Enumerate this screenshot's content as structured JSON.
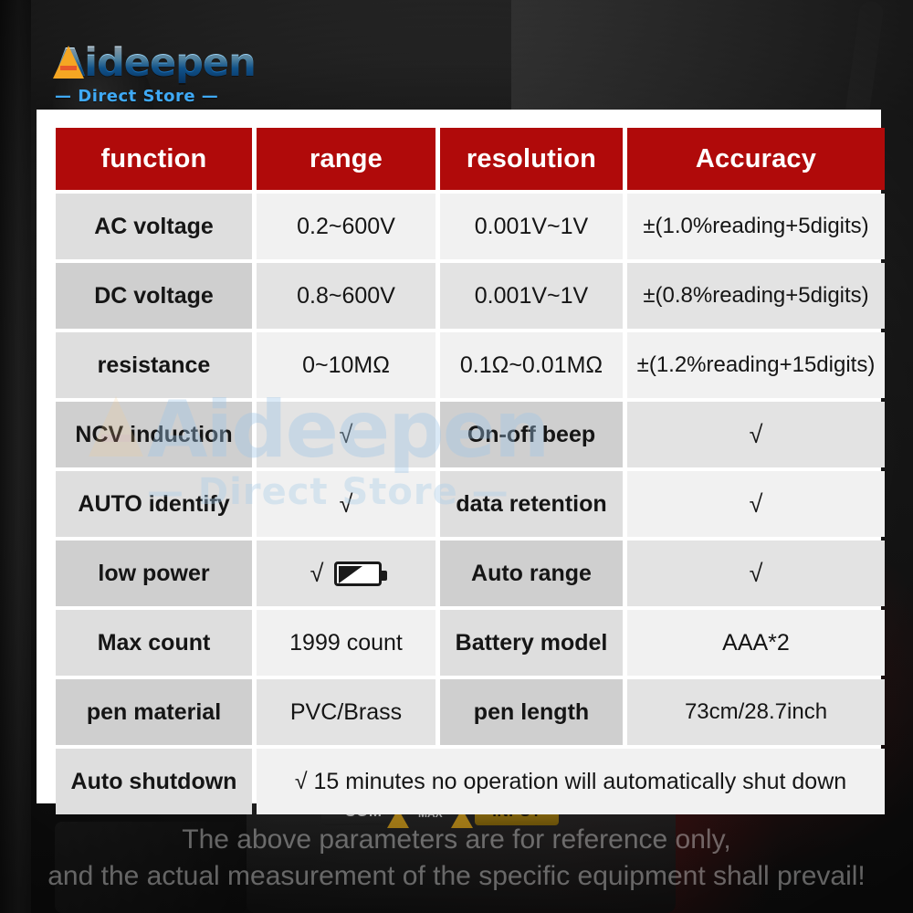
{
  "brand": {
    "name": "Aideepen",
    "tagline": "— Direct Store —",
    "watermark_name": "Aideepen",
    "watermark_tagline": "— Direct Store —",
    "logo_accent": "#f5a623",
    "logo_blue": "#1b7fd4"
  },
  "table": {
    "header_bg": "#b00a0a",
    "headers": [
      "function",
      "range",
      "resolution",
      "Accuracy"
    ],
    "rows": [
      {
        "cells": [
          "AC voltage",
          "0.2~600V",
          "0.001V~1V",
          "±(1.0%reading+5digits)"
        ]
      },
      {
        "cells": [
          "DC voltage",
          "0.8~600V",
          "0.001V~1V",
          "±(0.8%reading+5digits)"
        ]
      },
      {
        "cells": [
          "resistance",
          "0~10MΩ",
          "0.1Ω~0.01MΩ",
          "±(1.2%reading+15digits)"
        ]
      },
      {
        "cells": [
          "NCV induction",
          "√",
          "On-off beep",
          "√"
        ]
      },
      {
        "cells": [
          "AUTO identify",
          "√",
          "data retention",
          "√"
        ]
      },
      {
        "cells": [
          "low power",
          "√",
          "Auto range",
          "√"
        ],
        "icon": "battery-low-icon"
      },
      {
        "cells": [
          "Max count",
          "1999 count",
          "Battery model",
          "AAA*2"
        ]
      },
      {
        "cells": [
          "pen material",
          "PVC/Brass",
          "pen length",
          "73cm/28.7inch"
        ]
      }
    ],
    "last_row": {
      "label": "Auto shutdown",
      "value": "√ 15 minutes no operation will automatically shut down"
    }
  },
  "footer": {
    "line1": "The above parameters are for reference only,",
    "line2": "and the actual measurement of the specific equipment shall prevail!"
  },
  "background": {
    "jack_com": "COM",
    "jack_input": "INPUT",
    "max_label": "MAX"
  }
}
